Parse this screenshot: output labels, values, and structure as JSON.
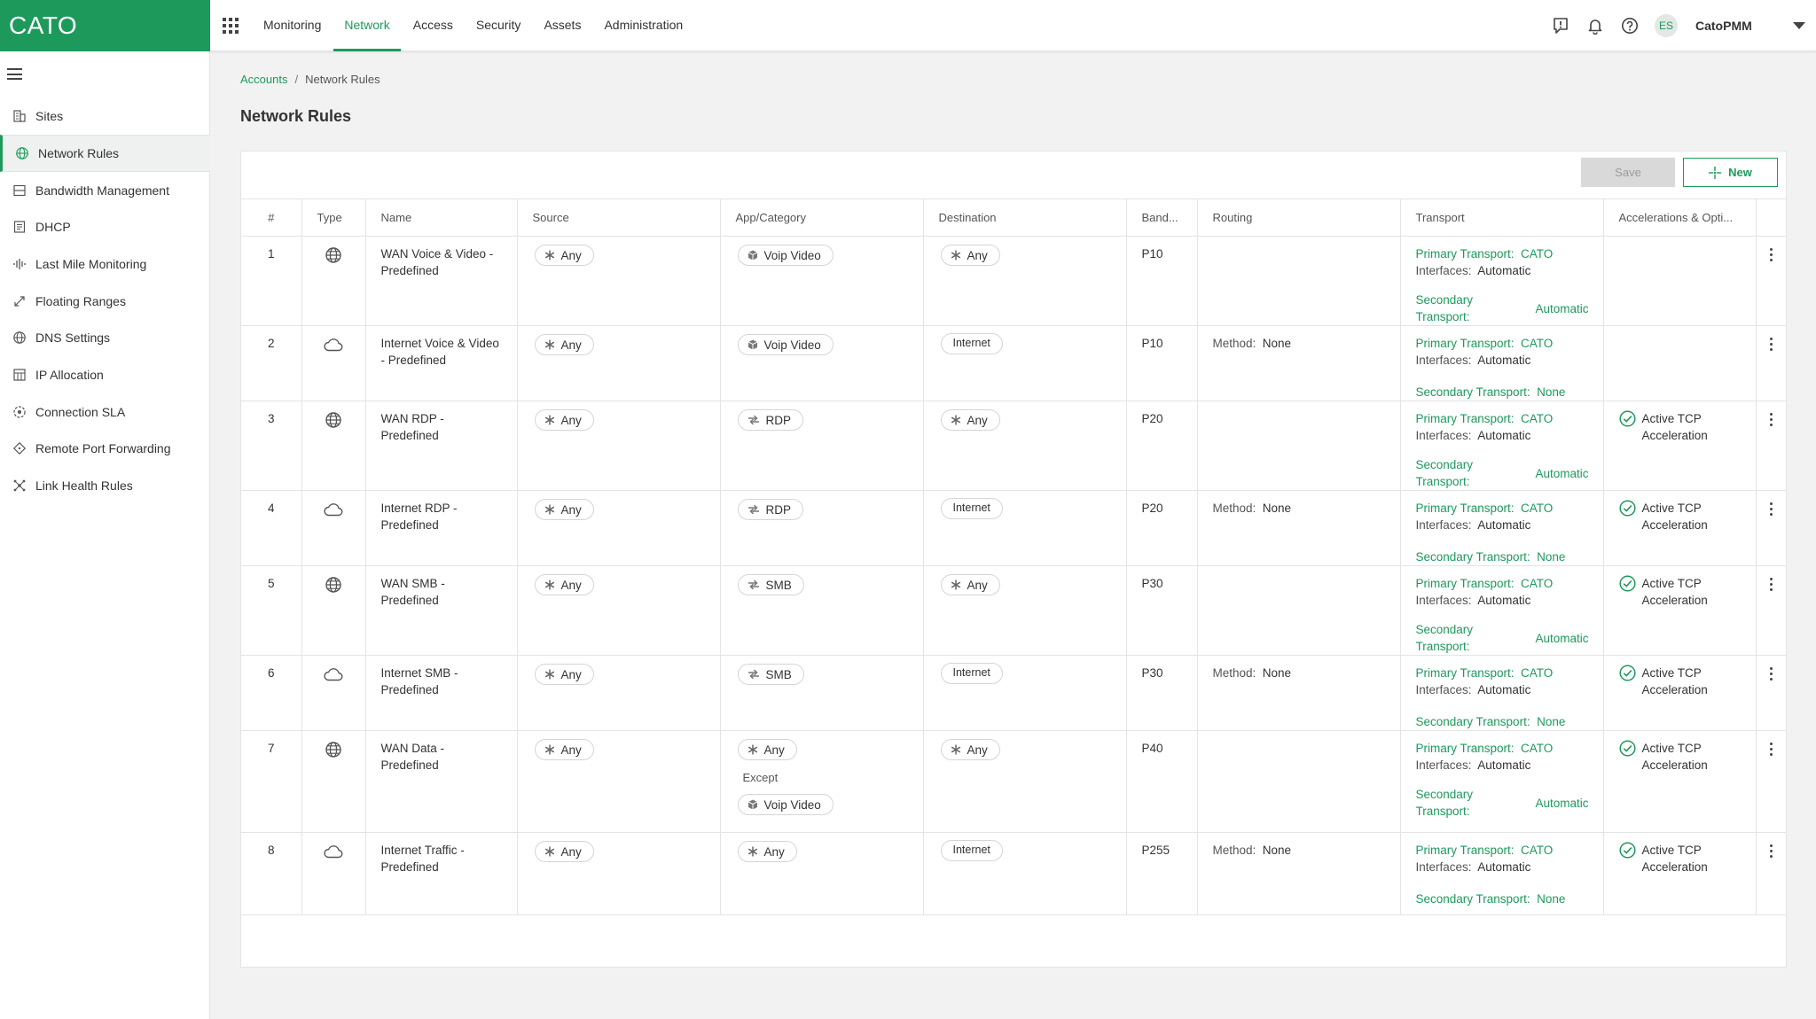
{
  "app": {
    "logo": "CATO"
  },
  "nav": {
    "items": [
      {
        "label": "Monitoring",
        "active": false
      },
      {
        "label": "Network",
        "active": true
      },
      {
        "label": "Access",
        "active": false
      },
      {
        "label": "Security",
        "active": false
      },
      {
        "label": "Assets",
        "active": false
      },
      {
        "label": "Administration",
        "active": false
      }
    ]
  },
  "header": {
    "avatar_initials": "ES",
    "account": "CatoPMM"
  },
  "sidebar": {
    "items": [
      {
        "label": "Sites",
        "icon": "sites-icon",
        "active": false
      },
      {
        "label": "Network Rules",
        "icon": "globe-icon",
        "active": true
      },
      {
        "label": "Bandwidth Management",
        "icon": "bandwidth-icon",
        "active": false
      },
      {
        "label": "DHCP",
        "icon": "dhcp-icon",
        "active": false
      },
      {
        "label": "Last Mile Monitoring",
        "icon": "waveform-icon",
        "active": false
      },
      {
        "label": "Floating Ranges",
        "icon": "expand-arrows-icon",
        "active": false
      },
      {
        "label": "DNS Settings",
        "icon": "globe-icon",
        "active": false
      },
      {
        "label": "IP Allocation",
        "icon": "grid-icon",
        "active": false
      },
      {
        "label": "Connection SLA",
        "icon": "target-icon",
        "active": false
      },
      {
        "label": "Remote Port Forwarding",
        "icon": "diamond-icon",
        "active": false
      },
      {
        "label": "Link Health Rules",
        "icon": "nodes-icon",
        "active": false
      }
    ]
  },
  "breadcrumb": {
    "root": "Accounts",
    "separator": "/",
    "current": "Network Rules"
  },
  "page": {
    "title": "Network Rules"
  },
  "toolbar": {
    "save_label": "Save",
    "new_label": "New"
  },
  "table": {
    "columns": [
      "#",
      "Type",
      "Name",
      "Source",
      "App/Category",
      "Destination",
      "Band...",
      "Routing",
      "Transport",
      "Accelerations & Opti..."
    ],
    "labels": {
      "primary_transport": "Primary Transport:",
      "interfaces": "Interfaces:",
      "secondary_transport": "Secondary Transport:",
      "secondary": "Secondary",
      "transport": "Transport:",
      "method": "Method:",
      "except": "Except",
      "accel_line1": "Active TCP",
      "accel_line2": "Acceleration"
    },
    "rows": [
      {
        "num": "1",
        "type": "wan",
        "name1": "WAN Voice & Video -",
        "name2": "Predefined",
        "source": "Any",
        "app": "Voip Video",
        "app_icon": "cube",
        "app_except": null,
        "destination": "Any",
        "dest_type": "any",
        "band": "P10",
        "routing": null,
        "primary": "CATO",
        "interfaces": "Automatic",
        "secondary": "Automatic",
        "secondary_inline": false,
        "accel": false,
        "height": 86
      },
      {
        "num": "2",
        "type": "internet",
        "name1": "Internet Voice & Video",
        "name2": "- Predefined",
        "source": "Any",
        "app": "Voip Video",
        "app_icon": "cube",
        "app_except": null,
        "destination": "Internet",
        "dest_type": "internet",
        "band": "P10",
        "routing": "None",
        "primary": "CATO",
        "interfaces": "Automatic",
        "secondary": "None",
        "secondary_inline": true,
        "accel": false,
        "height": 72
      },
      {
        "num": "3",
        "type": "wan",
        "name1": "WAN RDP -",
        "name2": "Predefined",
        "source": "Any",
        "app": "RDP",
        "app_icon": "arrows",
        "app_except": null,
        "destination": "Any",
        "dest_type": "any",
        "band": "P20",
        "routing": null,
        "primary": "CATO",
        "interfaces": "Automatic",
        "secondary": "Automatic",
        "secondary_inline": false,
        "accel": true,
        "height": 86
      },
      {
        "num": "4",
        "type": "internet",
        "name1": "Internet RDP -",
        "name2": "Predefined",
        "source": "Any",
        "app": "RDP",
        "app_icon": "arrows",
        "app_except": null,
        "destination": "Internet",
        "dest_type": "internet",
        "band": "P20",
        "routing": "None",
        "primary": "CATO",
        "interfaces": "Automatic",
        "secondary": "None",
        "secondary_inline": true,
        "accel": true,
        "height": 72
      },
      {
        "num": "5",
        "type": "wan",
        "name1": "WAN SMB -",
        "name2": "Predefined",
        "source": "Any",
        "app": "SMB",
        "app_icon": "arrows",
        "app_except": null,
        "destination": "Any",
        "dest_type": "any",
        "band": "P30",
        "routing": null,
        "primary": "CATO",
        "interfaces": "Automatic",
        "secondary": "Automatic",
        "secondary_inline": false,
        "accel": true,
        "height": 86
      },
      {
        "num": "6",
        "type": "internet",
        "name1": "Internet SMB -",
        "name2": "Predefined",
        "source": "Any",
        "app": "SMB",
        "app_icon": "arrows",
        "app_except": null,
        "destination": "Internet",
        "dest_type": "internet",
        "band": "P30",
        "routing": "None",
        "primary": "CATO",
        "interfaces": "Automatic",
        "secondary": "None",
        "secondary_inline": true,
        "accel": true,
        "height": 72
      },
      {
        "num": "7",
        "type": "wan",
        "name1": "WAN Data -",
        "name2": "Predefined",
        "source": "Any",
        "app": "Any",
        "app_icon": "asterisk",
        "app_except": "Voip Video",
        "destination": "Any",
        "dest_type": "any",
        "band": "P40",
        "routing": null,
        "primary": "CATO",
        "interfaces": "Automatic",
        "secondary": "Automatic",
        "secondary_inline": false,
        "accel": true,
        "height": 115
      },
      {
        "num": "8",
        "type": "internet",
        "name1": "Internet Traffic -",
        "name2": "Predefined",
        "source": "Any",
        "app": "Any",
        "app_icon": "asterisk",
        "app_except": null,
        "destination": "Internet",
        "dest_type": "internet",
        "band": "P255",
        "routing": "None",
        "primary": "CATO",
        "interfaces": "Automatic",
        "secondary": "None",
        "secondary_inline": true,
        "accel": true,
        "height": 93
      }
    ]
  }
}
